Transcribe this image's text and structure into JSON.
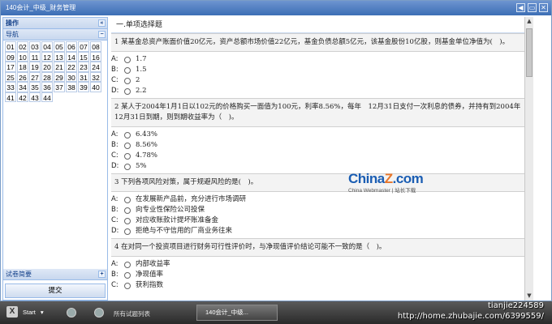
{
  "window": {
    "title": "140会计_中级_财务管理",
    "controls": [
      "◀",
      "▭",
      "✕"
    ]
  },
  "sidebar": {
    "header": "操作",
    "collapse_symbol": "«",
    "nav_header": "导航",
    "nav_toggle_symbol": "−",
    "numbers": [
      "01",
      "02",
      "03",
      "04",
      "05",
      "06",
      "07",
      "08",
      "09",
      "10",
      "11",
      "12",
      "13",
      "14",
      "15",
      "16",
      "17",
      "18",
      "19",
      "20",
      "21",
      "22",
      "23",
      "24",
      "25",
      "26",
      "27",
      "28",
      "29",
      "30",
      "31",
      "32",
      "33",
      "34",
      "35",
      "36",
      "37",
      "38",
      "39",
      "40",
      "41",
      "42",
      "43",
      "44"
    ],
    "summary_header": "试卷简要",
    "summary_toggle_symbol": "+",
    "submit_label": "提交"
  },
  "content": {
    "section_title": "一.单项选择题",
    "questions": [
      {
        "stem": "1 某基金总资产账面价值20亿元，资产总额市场价值22亿元，基金负债总额5亿元，该基金股份10亿股，则基金单位净值为(　)。",
        "options": [
          {
            "letter": "A:",
            "text": "1.7"
          },
          {
            "letter": "B:",
            "text": "1.5"
          },
          {
            "letter": "C:",
            "text": "2"
          },
          {
            "letter": "D:",
            "text": "2.2"
          }
        ]
      },
      {
        "stem": "2 某人于2004年1月1日以102元的价格购买一面值为100元，利率8.56%，每年　12月31日支付一次利息的债券，并持有到2004年12月31日到期，则到期收益率为（　)。",
        "options": [
          {
            "letter": "A:",
            "text": "6.43%"
          },
          {
            "letter": "B:",
            "text": "8.56%"
          },
          {
            "letter": "C:",
            "text": "4.78%"
          },
          {
            "letter": "D:",
            "text": "5%"
          }
        ]
      },
      {
        "stem": "3 下列各项风险对策，属于规避风险的是(　)。",
        "options": [
          {
            "letter": "A:",
            "text": "在发展新产品前，充分进行市场调研"
          },
          {
            "letter": "B:",
            "text": "向专业性保险公司投保"
          },
          {
            "letter": "C:",
            "text": "对应收账款计提坏账准备金"
          },
          {
            "letter": "D:",
            "text": "拒绝与不守信用的厂商业务往来"
          }
        ]
      },
      {
        "stem": "4 在对同一个投资项目进行财务可行性评价时，与净现值评价结论可能不一致的是（　)。",
        "options": [
          {
            "letter": "A:",
            "text": "内部收益率"
          },
          {
            "letter": "B:",
            "text": "净现值率"
          },
          {
            "letter": "C:",
            "text": "获利指数"
          }
        ]
      }
    ]
  },
  "watermark": {
    "brand_main": "China",
    "brand_z": "Z",
    "brand_tail": ".com",
    "brand_sub": "China Webmaster | 站长下载"
  },
  "taskbar": {
    "start_label": "Start",
    "start_logo": "X",
    "task_list": "所有试题列表",
    "active_task": "140会计_中级..."
  },
  "overlay": {
    "user": "tianjie224589",
    "url": "http://home.zhubajie.com/6399559/"
  }
}
